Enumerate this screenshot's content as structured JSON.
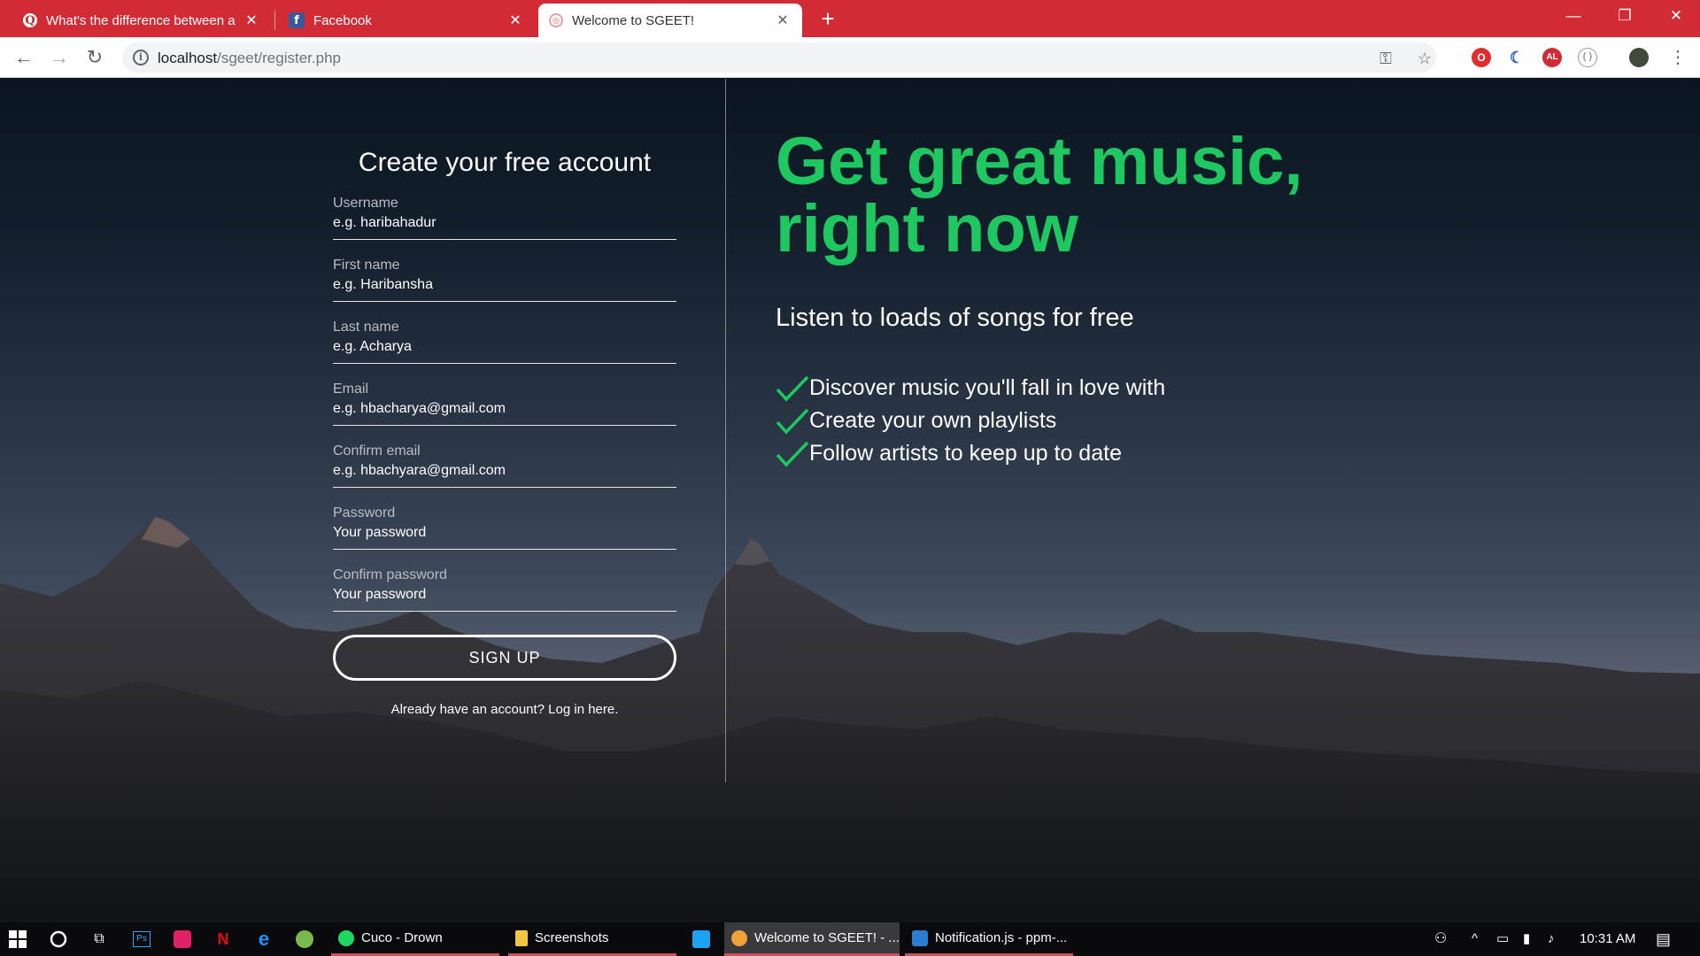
{
  "browser": {
    "tabs": [
      {
        "title": "What's the difference between a",
        "favicon": "quora-icon"
      },
      {
        "title": "Facebook",
        "favicon": "facebook-icon"
      },
      {
        "title": "Welcome to SGEET!",
        "favicon": "site-icon"
      }
    ],
    "new_tab": "+",
    "url_host": "localhost",
    "url_path": "/sgeet/register.php",
    "accent_color": "#d12b36"
  },
  "form": {
    "title": "Create your free account",
    "fields": [
      {
        "label": "Username",
        "placeholder": "e.g. haribahadur"
      },
      {
        "label": "First name",
        "placeholder": "e.g. Haribansha"
      },
      {
        "label": "Last name",
        "placeholder": "e.g. Acharya"
      },
      {
        "label": "Email",
        "placeholder": "e.g. hbacharya@gmail.com"
      },
      {
        "label": "Confirm email",
        "placeholder": "e.g. hbachyara@gmail.com"
      },
      {
        "label": "Password",
        "placeholder": "Your password"
      },
      {
        "label": "Confirm password",
        "placeholder": "Your password"
      }
    ],
    "submit_label": "SIGN UP",
    "login_link": "Already have an account? Log in here."
  },
  "hero": {
    "title_line1": "Get great music,",
    "title_line2": "right now",
    "subtitle": "Listen to loads of songs for free",
    "features": [
      "Discover music you'll fall in love with",
      "Create your own playlists",
      "Follow artists to keep up to date"
    ],
    "accent_color": "#1ec760"
  },
  "taskbar": {
    "apps": [
      {
        "label": "Cuco - Drown",
        "icon": "spotify-icon"
      },
      {
        "label": "Screenshots",
        "icon": "folder-icon"
      },
      {
        "label": "Welcome to SGEET! - ...",
        "icon": "chrome-icon"
      },
      {
        "label": "Notification.js - ppm-...",
        "icon": "vscode-icon"
      }
    ],
    "clock": "10:31 AM"
  }
}
